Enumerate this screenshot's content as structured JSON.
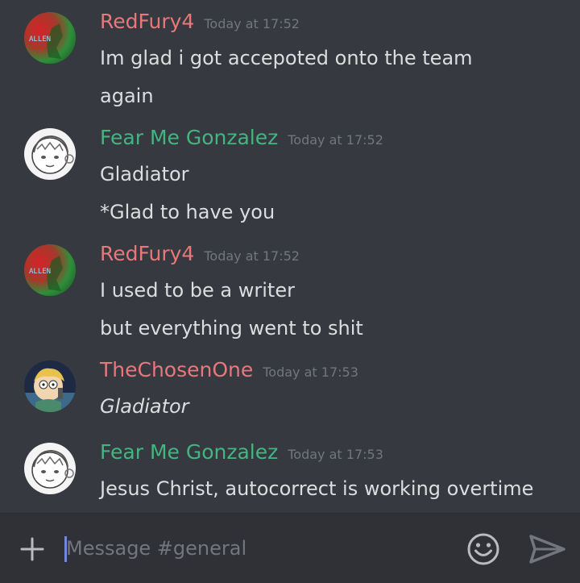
{
  "messages": [
    {
      "author": "RedFury4",
      "author_color": "#e8787a",
      "timestamp": "Today at 17:52",
      "avatar": "redfury4-avatar",
      "lines": [
        "Im glad i got accepoted onto the team",
        "again"
      ]
    },
    {
      "author": "Fear Me Gonzalez",
      "author_color": "#43b581",
      "timestamp": "Today at 17:52",
      "avatar": "gonzalez-avatar",
      "lines": [
        "Gladiator",
        "*Glad to have you"
      ]
    },
    {
      "author": "RedFury4",
      "author_color": "#e8787a",
      "timestamp": "Today at 17:52",
      "avatar": "redfury4-avatar",
      "lines": [
        "I used to be a writer",
        "but everything went to shit"
      ]
    },
    {
      "author": "TheChosenOne",
      "author_color": "#e8787a",
      "timestamp": "Today at 17:53",
      "avatar": "chosenone-avatar",
      "lines": [
        "Gladiator"
      ]
    },
    {
      "author": "Fear Me Gonzalez",
      "author_color": "#43b581",
      "timestamp": "Today at 17:53",
      "avatar": "gonzalez-avatar",
      "lines": [
        "Jesus Christ, autocorrect is working overtime"
      ]
    }
  ],
  "avatar_text": "ALLEN",
  "composer": {
    "placeholder": "Message #general",
    "value": "",
    "plus_icon": "plus-icon",
    "emoji_icon": "smiley-icon",
    "send_icon": "send-icon"
  }
}
